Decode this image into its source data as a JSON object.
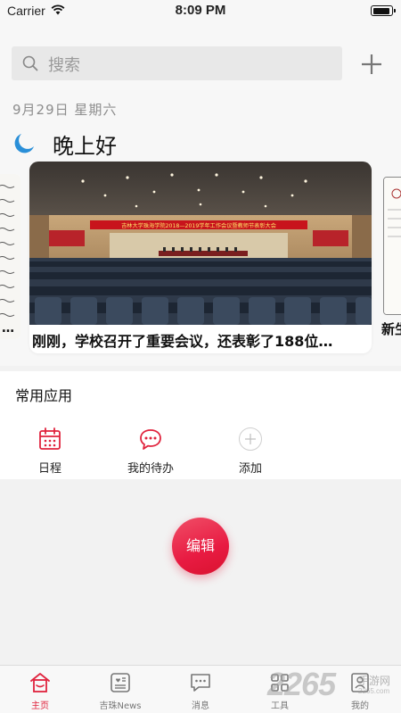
{
  "status_bar": {
    "carrier": "Carrier",
    "time": "8:09 PM"
  },
  "header": {
    "search_placeholder": "搜索",
    "add_icon": "plus-icon"
  },
  "greeting": {
    "date": "9月29日  星期六",
    "icon": "moon-icon",
    "text": "晚上好"
  },
  "news": {
    "main_caption": "刚刚，学校召开了重要会议，还表彰了188位…",
    "banner_text": "吉林大学珠海学院2018—2019学年工作会议暨教师节表彰大会",
    "left_ellipsis": "…",
    "right_caption": "新生"
  },
  "apps": {
    "title": "常用应用",
    "items": [
      {
        "label": "日程",
        "icon": "calendar-icon"
      },
      {
        "label": "我的待办",
        "icon": "chat-bubble-icon"
      },
      {
        "label": "添加",
        "icon": "add-circle-icon"
      }
    ]
  },
  "edit_label": "编辑",
  "tabs": [
    {
      "label": "主页",
      "icon": "home-icon",
      "active": true
    },
    {
      "label": "吉珠News",
      "icon": "news-icon",
      "active": false
    },
    {
      "label": "消息",
      "icon": "message-icon",
      "active": false
    },
    {
      "label": "工具",
      "icon": "tools-icon",
      "active": false
    },
    {
      "label": "我的",
      "icon": "profile-icon",
      "active": false
    }
  ],
  "watermark": {
    "number": "2265",
    "domain": "手游网",
    "sub": "2265.com"
  },
  "colors": {
    "accent": "#e0233d",
    "moon": "#2a8fd8",
    "background": "#f2f2f2"
  }
}
